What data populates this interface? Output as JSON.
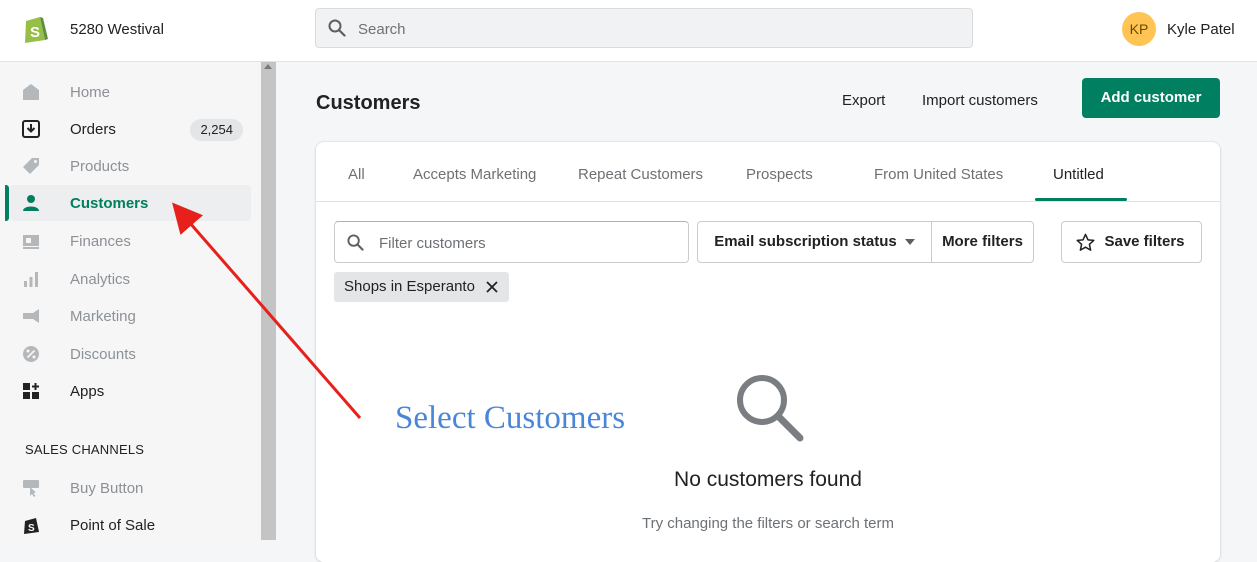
{
  "header": {
    "store_name": "5280 Westival",
    "search_placeholder": "Search",
    "user_initials": "KP",
    "user_name": "Kyle Patel"
  },
  "sidebar": {
    "items": [
      {
        "label": "Home",
        "icon": "home-icon"
      },
      {
        "label": "Orders",
        "icon": "orders-icon",
        "badge": "2,254"
      },
      {
        "label": "Products",
        "icon": "tag-icon"
      },
      {
        "label": "Customers",
        "icon": "person-icon",
        "active": true
      },
      {
        "label": "Finances",
        "icon": "finances-icon"
      },
      {
        "label": "Analytics",
        "icon": "bar-chart-icon"
      },
      {
        "label": "Marketing",
        "icon": "megaphone-icon"
      },
      {
        "label": "Discounts",
        "icon": "discount-icon"
      },
      {
        "label": "Apps",
        "icon": "apps-icon"
      }
    ],
    "sales_channels_title": "SALES CHANNELS",
    "channels": [
      {
        "label": "Buy Button",
        "icon": "buy-button-icon"
      },
      {
        "label": "Point of Sale",
        "icon": "pos-icon"
      }
    ]
  },
  "page": {
    "title": "Customers",
    "export_label": "Export",
    "import_label": "Import customers",
    "add_label": "Add customer"
  },
  "tabs": [
    "All",
    "Accepts Marketing",
    "Repeat Customers",
    "Prospects",
    "From United States",
    "Untitled"
  ],
  "filters": {
    "placeholder": "Filter customers",
    "email_status_label": "Email subscription status",
    "more_filters_label": "More filters",
    "save_filters_label": "Save filters",
    "applied_tag": "Shops in Esperanto"
  },
  "empty_state": {
    "title": "No customers found",
    "subtitle": "Try changing the filters or search term"
  },
  "annotation": {
    "text": "Select Customers",
    "color": "#4a86d8",
    "arrow_color": "#e8201b"
  },
  "colors": {
    "brand_green": "#008060",
    "active_text": "#007f5f"
  }
}
